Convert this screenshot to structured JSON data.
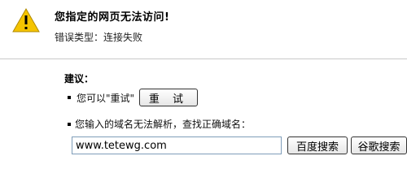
{
  "header": {
    "icon": "warning-icon",
    "title": "您指定的网页无法访问!",
    "error_type": "错误类型：连接失败"
  },
  "suggestions": {
    "heading": "建议：",
    "retry_text": "您可以\"重试\"",
    "retry_button": "重 试",
    "domain_text": "您输入的域名无法解析，查找正确域名：",
    "url_value": "www.tetewg.com",
    "baidu_button": "百度搜索",
    "google_button": "谷歌搜索"
  },
  "colors": {
    "warning_fill": "#f5c400",
    "divider": "#c8c8c8"
  }
}
